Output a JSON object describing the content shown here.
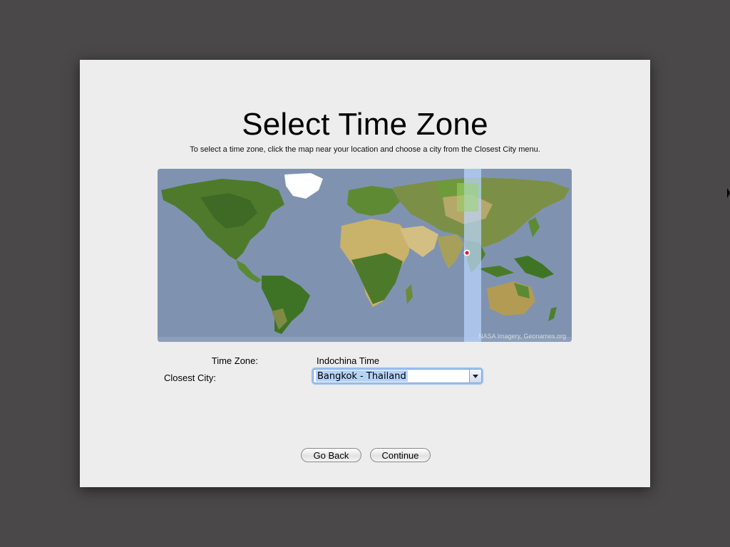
{
  "header": {
    "title": "Select Time Zone",
    "instructions": "To select a time zone, click the map near your location and choose a city from the Closest City menu."
  },
  "map": {
    "credit": "NASA Imagery, Geonames.org",
    "selected_band_color": "#bcd6ff",
    "ocean_color": "#7f93b0"
  },
  "fields": {
    "time_zone_label": "Time Zone:",
    "time_zone_value": "Indochina Time",
    "closest_city_label": "Closest City:",
    "closest_city_value": "Bangkok - Thailand"
  },
  "buttons": {
    "back_label": "Go Back",
    "continue_label": "Continue"
  }
}
